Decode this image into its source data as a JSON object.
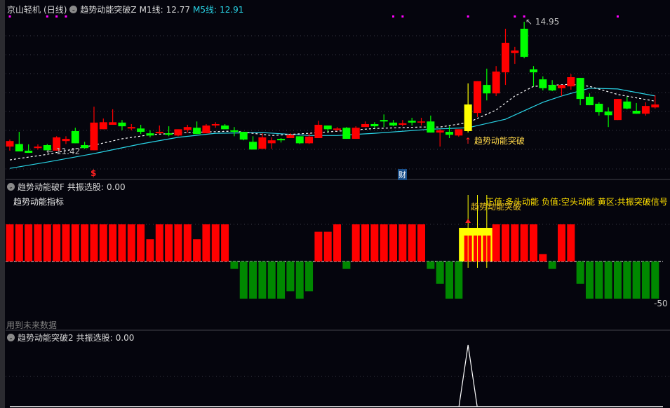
{
  "main_panel": {
    "stock_name": "京山轻机",
    "period": "(日线)",
    "indicator_name": "趋势动能突破Z",
    "m1_label": "M1线:",
    "m1_value": "12.77",
    "m5_label": "M5线:",
    "m5_value": "12.91",
    "high_label": "14.95",
    "low_label": "11.42",
    "signal_label": "趋势动能突破",
    "marker_dollar": "$",
    "marker_cai": "财"
  },
  "panel2": {
    "indicator_name": "趋势动能破F",
    "resonance_label": "共振选股:",
    "resonance_value": "0.00",
    "title": "趋势动能指标",
    "legend": "正值:多头动能  负值:空头动能  黄区:共振突破信号",
    "signal_label": "趋势动能突破",
    "axis_min_label": "-50",
    "future_data_note": "用到未来数据"
  },
  "panel3": {
    "indicator_name": "趋势动能突破2",
    "resonance_label": "共振选股:",
    "resonance_value": "0.00"
  },
  "colors": {
    "up": "#ff0000",
    "down": "#00ff00",
    "yellow": "#ffff00",
    "ma1": "#ffffff",
    "ma5": "#29d4e6",
    "pos_bar": "#ff0000",
    "neg_bar": "#008800",
    "marker": "#ff00ff"
  },
  "chart_data": {
    "type": "candlestick",
    "candles": [
      [
        11.57,
        11.76,
        11.46,
        11.72
      ],
      [
        11.64,
        11.97,
        11.44,
        11.44
      ],
      [
        11.46,
        11.63,
        11.4,
        11.4
      ],
      [
        11.53,
        11.63,
        11.49,
        11.57
      ],
      [
        11.61,
        11.64,
        11.47,
        11.47
      ],
      [
        11.46,
        11.85,
        11.46,
        11.82
      ],
      [
        11.72,
        11.85,
        11.64,
        11.78
      ],
      [
        11.99,
        12.08,
        11.66,
        11.66
      ],
      [
        11.61,
        11.7,
        11.51,
        11.53
      ],
      [
        11.47,
        12.65,
        11.47,
        12.22
      ],
      [
        12.04,
        12.33,
        12.04,
        12.23
      ],
      [
        12.16,
        12.58,
        12.16,
        12.23
      ],
      [
        12.22,
        12.29,
        12.01,
        12.12
      ],
      [
        12.06,
        12.18,
        12.01,
        12.1
      ],
      [
        12.06,
        12.16,
        11.91,
        11.97
      ],
      [
        11.93,
        12.01,
        11.82,
        11.87
      ],
      [
        11.93,
        12.14,
        11.91,
        11.97
      ],
      [
        11.93,
        12.12,
        11.85,
        11.89
      ],
      [
        11.87,
        12.04,
        11.85,
        12.04
      ],
      [
        12.02,
        12.16,
        11.95,
        12.1
      ],
      [
        12.08,
        12.25,
        11.91,
        11.91
      ],
      [
        11.93,
        12.18,
        11.93,
        12.14
      ],
      [
        12.14,
        12.23,
        12.08,
        12.18
      ],
      [
        12.14,
        12.18,
        12.04,
        12.04
      ],
      [
        12.01,
        12.1,
        11.85,
        11.97
      ],
      [
        11.97,
        11.97,
        11.74,
        11.76
      ],
      [
        11.7,
        11.85,
        11.49,
        11.49
      ],
      [
        11.51,
        11.93,
        11.51,
        11.82
      ],
      [
        11.66,
        11.82,
        11.51,
        11.74
      ],
      [
        11.78,
        11.8,
        11.68,
        11.74
      ],
      [
        11.8,
        11.93,
        11.8,
        11.89
      ],
      [
        11.85,
        11.85,
        11.64,
        11.66
      ],
      [
        11.66,
        11.93,
        11.64,
        11.84
      ],
      [
        11.8,
        12.27,
        11.8,
        12.16
      ],
      [
        12.14,
        12.14,
        11.97,
        12.04
      ],
      [
        12.02,
        12.1,
        11.99,
        12.06
      ],
      [
        12.08,
        12.1,
        11.78,
        11.78
      ],
      [
        11.78,
        12.12,
        11.78,
        12.08
      ],
      [
        12.1,
        12.25,
        12.1,
        12.18
      ],
      [
        12.18,
        12.23,
        12.08,
        12.12
      ],
      [
        12.29,
        12.44,
        12.1,
        12.25
      ],
      [
        12.22,
        12.29,
        12.12,
        12.14
      ],
      [
        12.16,
        12.29,
        12.12,
        12.2
      ],
      [
        12.27,
        12.35,
        12.14,
        12.22
      ],
      [
        12.22,
        12.35,
        12.14,
        12.25
      ],
      [
        12.25,
        12.41,
        11.95,
        11.95
      ],
      [
        11.95,
        12.04,
        11.57,
        12.01
      ],
      [
        11.97,
        12.12,
        11.8,
        11.89
      ],
      [
        11.87,
        12.04,
        11.84,
        12.04
      ],
      [
        11.99,
        13.28,
        11.95,
        12.71
      ],
      [
        12.48,
        13.34,
        12.37,
        13.34
      ],
      [
        13.24,
        13.68,
        12.82,
        13.01
      ],
      [
        13.01,
        13.75,
        12.94,
        13.6
      ],
      [
        13.58,
        14.76,
        13.24,
        14.38
      ],
      [
        14.1,
        14.27,
        13.81,
        14.17
      ],
      [
        14.76,
        14.95,
        13.96,
        14.0
      ],
      [
        13.66,
        13.75,
        13.2,
        13.58
      ],
      [
        13.39,
        13.47,
        13.09,
        13.15
      ],
      [
        13.24,
        13.37,
        13.07,
        13.09
      ],
      [
        13.15,
        13.24,
        12.94,
        13.24
      ],
      [
        13.2,
        13.53,
        13.11,
        13.45
      ],
      [
        13.43,
        13.43,
        12.69,
        12.86
      ],
      [
        12.92,
        13.01,
        12.69,
        12.69
      ],
      [
        12.73,
        12.77,
        12.41,
        12.5
      ],
      [
        12.52,
        12.63,
        12.1,
        12.42
      ],
      [
        12.29,
        12.86,
        12.29,
        12.86
      ],
      [
        12.79,
        12.92,
        12.58,
        12.6
      ],
      [
        12.54,
        12.75,
        12.46,
        12.46
      ],
      [
        12.46,
        12.77,
        12.41,
        12.67
      ],
      [
        12.63,
        12.96,
        12.6,
        12.71
      ]
    ],
    "candle_fields": [
      "open",
      "high",
      "low",
      "close"
    ],
    "highlight_candle_index": 49,
    "ma1_points": [
      [
        0,
        11.21
      ],
      [
        4,
        11.36
      ],
      [
        9,
        11.61
      ],
      [
        12,
        11.78
      ],
      [
        15,
        11.89
      ],
      [
        19,
        11.95
      ],
      [
        24,
        11.99
      ],
      [
        28,
        11.87
      ],
      [
        32,
        11.93
      ],
      [
        39,
        12.06
      ],
      [
        44,
        12.1
      ],
      [
        46,
        12.1
      ],
      [
        49,
        12.22
      ],
      [
        52,
        12.56
      ],
      [
        54,
        12.94
      ],
      [
        56,
        13.2
      ],
      [
        60,
        13.26
      ],
      [
        62,
        13.2
      ],
      [
        65,
        12.98
      ],
      [
        69,
        12.8
      ]
    ],
    "ma5_points": [
      [
        0,
        10.98
      ],
      [
        4,
        11.15
      ],
      [
        9,
        11.38
      ],
      [
        14,
        11.64
      ],
      [
        18,
        11.82
      ],
      [
        22,
        11.93
      ],
      [
        27,
        11.95
      ],
      [
        32,
        11.87
      ],
      [
        35,
        11.87
      ],
      [
        39,
        11.93
      ],
      [
        45,
        12.04
      ],
      [
        49,
        12.08
      ],
      [
        53,
        12.31
      ],
      [
        57,
        12.77
      ],
      [
        59,
        12.94
      ],
      [
        62,
        13.15
      ],
      [
        65,
        13.13
      ],
      [
        69,
        12.94
      ]
    ],
    "marker_indices": [
      0,
      4,
      5,
      6,
      41,
      42,
      49,
      54,
      55,
      65
    ],
    "momentum": [
      50,
      50,
      50,
      50,
      50,
      50,
      50,
      50,
      50,
      50,
      50,
      50,
      50,
      50,
      50,
      30,
      50,
      50,
      50,
      50,
      30,
      50,
      50,
      50,
      -10,
      -50,
      -50,
      -50,
      -50,
      -50,
      -40,
      -50,
      -40,
      40,
      40,
      50,
      -10,
      50,
      50,
      50,
      50,
      50,
      50,
      50,
      50,
      -10,
      -30,
      -50,
      -50,
      50,
      50,
      50,
      50,
      50,
      50,
      50,
      50,
      10,
      -10,
      50,
      50,
      -30,
      -50,
      -50,
      -50,
      -50,
      -50,
      -50,
      -50,
      -50
    ],
    "resonance_zone": [
      49,
      51
    ],
    "signal2": {
      "index": 49,
      "value": 1
    }
  }
}
